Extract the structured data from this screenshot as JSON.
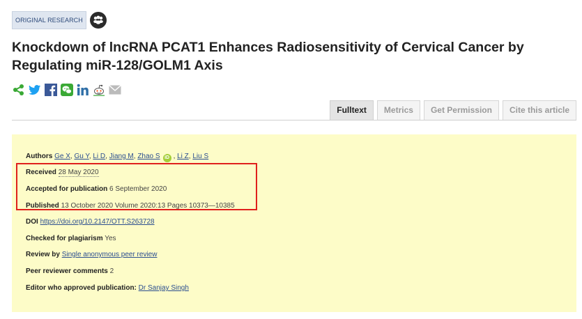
{
  "badge": {
    "label": "ORIGINAL RESEARCH",
    "icon": "group-icon"
  },
  "title": "Knockdown of lncRNA PCAT1 Enhances Radiosensitivity of Cervical Cancer by Regulating miR-128/GOLM1 Axis",
  "share_icons": [
    "share-icon",
    "twitter-icon",
    "facebook-icon",
    "wechat-icon",
    "linkedin-icon",
    "reddit-icon",
    "email-icon"
  ],
  "colors": {
    "accent_green": "#3aa935",
    "twitter": "#1da1f2",
    "facebook": "#3b5998",
    "panel_bg": "#fdfcc8",
    "highlight_border": "#e0201c"
  },
  "tabs": [
    {
      "label": "Fulltext",
      "active": true
    },
    {
      "label": "Metrics",
      "active": false
    },
    {
      "label": "Get Permission",
      "active": false
    },
    {
      "label": "Cite this article",
      "active": false
    }
  ],
  "info": {
    "authors_label": "Authors",
    "authors": [
      "Ge X",
      "Gu Y",
      "Li D",
      "Jiang M",
      "Zhao S",
      "Li Z",
      "Liu S"
    ],
    "orcid_label": "iD",
    "received_label": "Received",
    "received": "28 May 2020",
    "accepted_label": "Accepted for publication",
    "accepted": "6 September 2020",
    "published_label": "Published",
    "published": "13 October 2020 Volume 2020:13 Pages 10373—10385",
    "doi_label": "DOI",
    "doi": "https://doi.org/10.2147/OTT.S263728",
    "plagiarism_label": "Checked for plagiarism",
    "plagiarism": "Yes",
    "review_label": "Review by",
    "review": "Single anonymous peer review",
    "comments_label": "Peer reviewer comments",
    "comments": "2",
    "editor_label": "Editor who approved publication:",
    "editor": "Dr Sanjay Singh"
  }
}
